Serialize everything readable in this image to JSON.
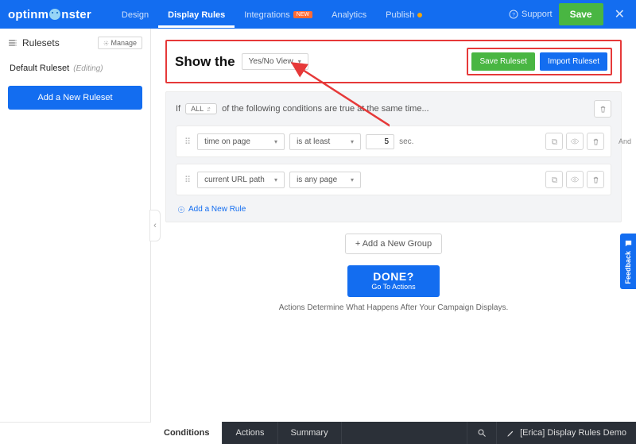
{
  "brand": "optinmonster",
  "nav": {
    "design": "Design",
    "display_rules": "Display Rules",
    "integrations": "Integrations",
    "integrations_badge": "NEW",
    "analytics": "Analytics",
    "publish": "Publish"
  },
  "top_right": {
    "support": "Support",
    "save": "Save"
  },
  "sidebar": {
    "title": "Rulesets",
    "manage": "Manage",
    "item_name": "Default Ruleset",
    "editing": "(Editing)",
    "add_btn": "Add a New Ruleset"
  },
  "header": {
    "show_the": "Show the",
    "view_select": "Yes/No View",
    "save_ruleset": "Save Ruleset",
    "import_ruleset": "Import Ruleset"
  },
  "group": {
    "if": "If",
    "all": "ALL",
    "sentence": "of the following conditions are true at the same time...",
    "and": "And"
  },
  "rule1": {
    "field": "time on page",
    "op": "is at least",
    "value": "5",
    "unit": "sec."
  },
  "rule2": {
    "field": "current URL path",
    "op": "is any page"
  },
  "add_rule": "Add a New Rule",
  "add_group": "+ Add a New Group",
  "done": {
    "big": "DONE?",
    "small": "Go To Actions"
  },
  "help": "Actions Determine What Happens After Your Campaign Displays.",
  "feedback": "Feedback",
  "bottom": {
    "conditions": "Conditions",
    "actions": "Actions",
    "summary": "Summary",
    "campaign": "[Erica] Display Rules Demo"
  }
}
